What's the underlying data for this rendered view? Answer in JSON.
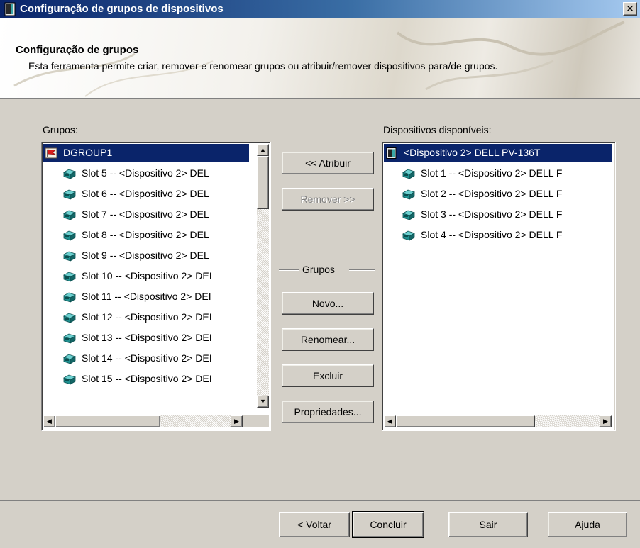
{
  "window": {
    "title": "Configuração de grupos de dispositivos",
    "close_label": "✕"
  },
  "header": {
    "title": "Configuração de grupos",
    "description": "Esta ferramenta permite criar, remover e renomear grupos ou atribuir/remover dispositivos para/de grupos."
  },
  "groups_panel": {
    "label": "Grupos:",
    "items": [
      {
        "label": "DGROUP1",
        "icon": "group-flag-icon",
        "selected": true,
        "indent": false
      },
      {
        "label": "Slot  5  -- <Dispositivo  2> DEL",
        "icon": "tape-cartridge-icon"
      },
      {
        "label": "Slot  6  -- <Dispositivo  2> DEL",
        "icon": "tape-cartridge-icon"
      },
      {
        "label": "Slot  7  -- <Dispositivo  2> DEL",
        "icon": "tape-cartridge-icon"
      },
      {
        "label": "Slot  8  -- <Dispositivo  2> DEL",
        "icon": "tape-cartridge-icon"
      },
      {
        "label": "Slot  9  -- <Dispositivo  2> DEL",
        "icon": "tape-cartridge-icon"
      },
      {
        "label": "Slot 10  -- <Dispositivo  2> DEI",
        "icon": "tape-cartridge-icon"
      },
      {
        "label": "Slot 11  -- <Dispositivo  2> DEI",
        "icon": "tape-cartridge-icon"
      },
      {
        "label": "Slot 12  -- <Dispositivo  2> DEI",
        "icon": "tape-cartridge-icon"
      },
      {
        "label": "Slot 13  -- <Dispositivo  2> DEI",
        "icon": "tape-cartridge-icon"
      },
      {
        "label": "Slot 14  -- <Dispositivo  2> DEI",
        "icon": "tape-cartridge-icon"
      },
      {
        "label": "Slot 15  -- <Dispositivo  2> DEI",
        "icon": "tape-cartridge-icon"
      }
    ]
  },
  "devices_panel": {
    "label": "Dispositivos disponíveis:",
    "items": [
      {
        "label": "<Dispositivo  2> DELL PV-136T",
        "icon": "tape-library-icon",
        "selected": true
      },
      {
        "label": "Slot  1  -- <Dispositivo  2> DELL F",
        "icon": "tape-cartridge-icon"
      },
      {
        "label": "Slot  2  -- <Dispositivo  2> DELL F",
        "icon": "tape-cartridge-icon"
      },
      {
        "label": "Slot  3  -- <Dispositivo  2> DELL F",
        "icon": "tape-cartridge-icon"
      },
      {
        "label": "Slot  4  -- <Dispositivo  2> DELL F",
        "icon": "tape-cartridge-icon"
      }
    ]
  },
  "middle": {
    "assign": "<< Atribuir",
    "remove": "Remover >>",
    "groups_section": "Grupos",
    "new": "Novo...",
    "rename": "Renomear...",
    "delete": "Excluir",
    "properties": "Propriedades..."
  },
  "footer": {
    "back": "< Voltar",
    "finish": "Concluir",
    "exit": "Sair",
    "help": "Ajuda"
  },
  "colors": {
    "selection": "#0a246a",
    "face": "#d4d0c8",
    "cartridge": "#1f8f8f"
  }
}
